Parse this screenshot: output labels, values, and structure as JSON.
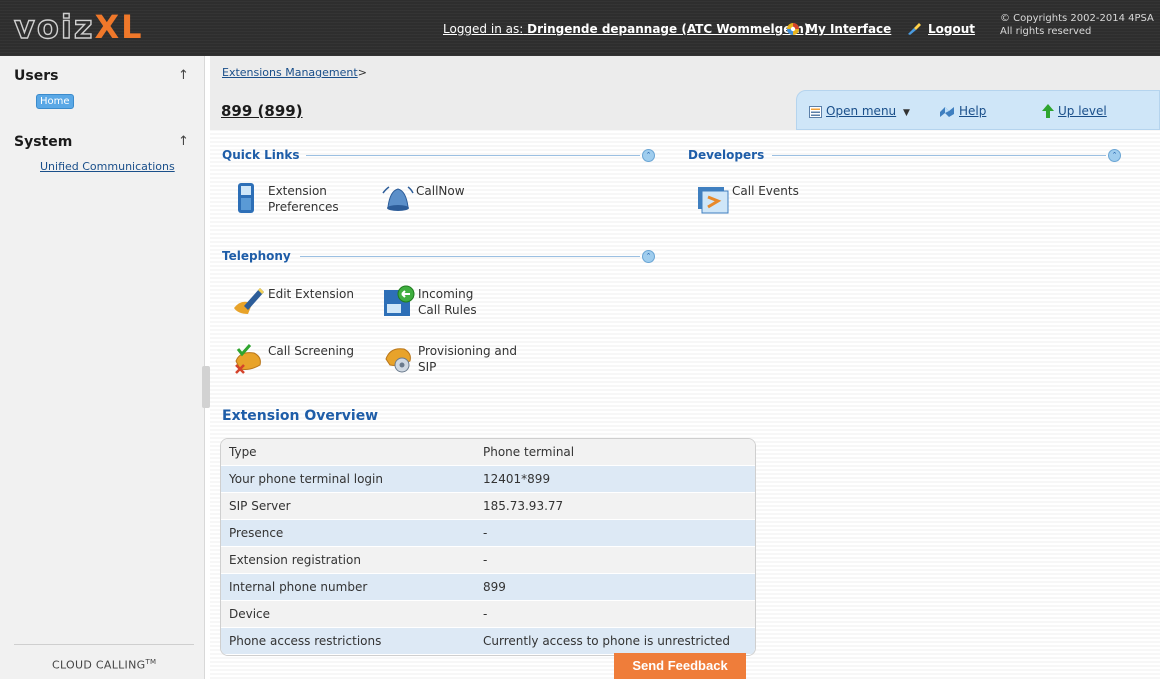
{
  "header": {
    "logo_voiz": "voiz",
    "logo_xl": "XL",
    "logged_in_prefix": "Logged in as:",
    "logged_in_user": "Dringende depannage (ATC Wommelgem)",
    "my_interface": "My Interface",
    "logout": "Logout",
    "copyright_line1": "© Copyrights 2002-2014 4PSA",
    "copyright_line2": "All rights reserved"
  },
  "sidebar": {
    "users_label": "Users",
    "home_label": "Home",
    "system_label": "System",
    "unified_label": "Unified Communications",
    "collapse_arrow": "↑",
    "cloud_label": "CLOUD CALLING",
    "cloud_tm": "TM"
  },
  "topbar": {
    "breadcrumb_link": "Extensions Management",
    "breadcrumb_sep": ">",
    "title": "899 (899)",
    "open_menu": "Open menu",
    "open_menu_caret": "▼",
    "help": "Help",
    "up_level": "Up level"
  },
  "sections": {
    "quick_links": "Quick Links",
    "developers": "Developers",
    "telephony": "Telephony"
  },
  "quick_links": {
    "ext_pref": "Extension Preferences",
    "callnow": "CallNow"
  },
  "developers": {
    "call_events": "Call Events"
  },
  "telephony": {
    "edit_extension": "Edit Extension",
    "incoming_rules": "Incoming Call Rules",
    "call_screening": "Call Screening",
    "provisioning": "Provisioning and SIP"
  },
  "overview": {
    "title": "Extension Overview",
    "rows": [
      {
        "label": "Type",
        "value": "Phone terminal"
      },
      {
        "label": "Your phone terminal login",
        "value": "12401*899"
      },
      {
        "label": "SIP Server",
        "value": "185.73.93.77"
      },
      {
        "label": "Presence",
        "value": "-"
      },
      {
        "label": "Extension registration",
        "value": "-"
      },
      {
        "label": "Internal phone number",
        "value": "899"
      },
      {
        "label": "Device",
        "value": "-"
      },
      {
        "label": "Phone access restrictions",
        "value": "Currently access to phone is unrestricted"
      }
    ]
  },
  "feedback": "Send Feedback",
  "colors": {
    "accent_orange": "#ef7d3a",
    "link_blue": "#1a4f8a",
    "section_blue": "#1e5da8",
    "toolbar_bg": "#cfe6f8"
  }
}
